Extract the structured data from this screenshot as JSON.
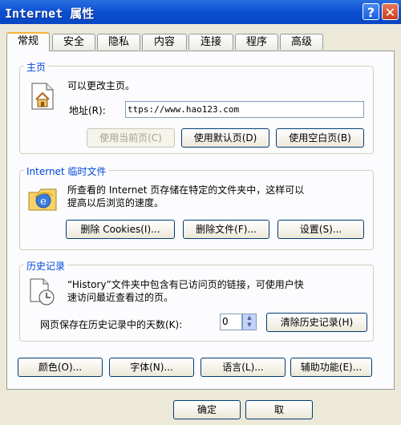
{
  "window": {
    "title": "Internet 属性"
  },
  "tabs": [
    "常规",
    "安全",
    "隐私",
    "内容",
    "连接",
    "程序",
    "高级"
  ],
  "home": {
    "label": "主页",
    "desc": "可以更改主页。",
    "address_label": "地址(R):",
    "address_value": "ttps://www.hao123.com",
    "btn_current": "使用当前页(C)",
    "btn_default": "使用默认页(D)",
    "btn_blank": "使用空白页(B)"
  },
  "temp": {
    "label": "Internet 临时文件",
    "desc1": "所查看的 Internet 页存储在特定的文件夹中，这样可以",
    "desc2": "提高以后浏览的速度。",
    "btn_cookies": "删除 Cookies(I)...",
    "btn_files": "删除文件(F)...",
    "btn_settings": "设置(S)..."
  },
  "history": {
    "label": "历史记录",
    "desc1": "“History”文件夹中包含有已访问页的链接，可使用户快",
    "desc2": "速访问最近查看过的页。",
    "days_label": "网页保存在历史记录中的天数(K):",
    "days_value": "0",
    "btn_clear": "清除历史记录(H)"
  },
  "bottom": {
    "colors": "颜色(O)...",
    "fonts": "字体(N)...",
    "languages": "语言(L)...",
    "accessibility": "辅助功能(E)..."
  },
  "footer": {
    "ok": "确定",
    "cancel": "取"
  }
}
